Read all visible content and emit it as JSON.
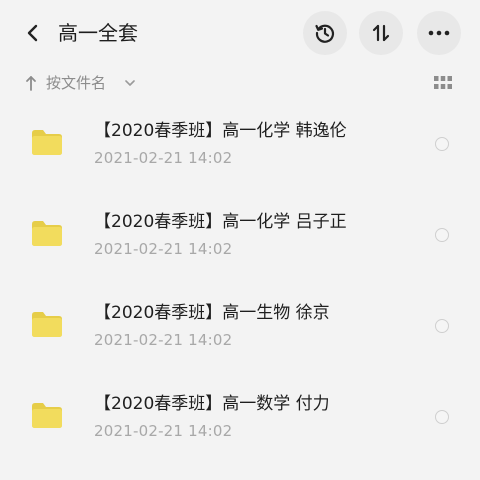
{
  "header": {
    "title": "高一全套",
    "back_icon": "chevron-left-icon",
    "history_icon": "history-icon",
    "sort_icon": "sort-arrows-icon",
    "more_icon": "more-icon"
  },
  "sortbar": {
    "label": "按文件名",
    "direction_icon": "arrow-up-icon",
    "dropdown_icon": "chevron-down-icon",
    "view_icon": "grid-view-icon"
  },
  "colors": {
    "background": "#f3f3f3",
    "folder": "#f2dc5d",
    "folder_tab": "#e6cd48",
    "secondary_text": "#a8a8a8"
  },
  "files": [
    {
      "name": "【2020春季班】高一化学 韩逸伦",
      "date": "2021-02-21  14:02",
      "icon": "folder-icon"
    },
    {
      "name": "【2020春季班】高一化学 吕子正",
      "date": "2021-02-21  14:02",
      "icon": "folder-icon"
    },
    {
      "name": "【2020春季班】高一生物 徐京",
      "date": "2021-02-21  14:02",
      "icon": "folder-icon"
    },
    {
      "name": "【2020春季班】高一数学 付力",
      "date": "2021-02-21  14:02",
      "icon": "folder-icon"
    }
  ]
}
